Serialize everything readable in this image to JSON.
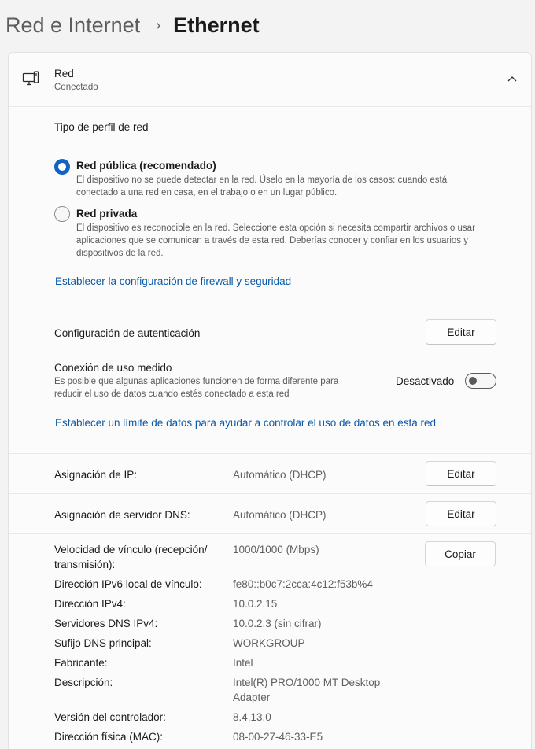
{
  "breadcrumb": {
    "parent": "Red e Internet",
    "separator": "›",
    "current": "Ethernet"
  },
  "network": {
    "name": "Red",
    "status": "Conectado",
    "icon": "computer-network-icon",
    "expand_icon": "chevron-up-icon"
  },
  "profile": {
    "heading": "Tipo de perfil de red",
    "options": [
      {
        "label": "Red pública (recomendado)",
        "selected": true,
        "desc1": "El dispositivo no se puede detectar en la red. Úselo en la mayoría de los casos: cuando está",
        "desc2": "conectado a una red en casa, en el trabajo o en un lugar público."
      },
      {
        "label": "Red privada",
        "selected": false,
        "desc1": "El dispositivo es reconocible en la red. Seleccione esta opción si necesita compartir archivos o usar",
        "desc2": "aplicaciones que se comunican a través de esta red. Deberías conocer y confiar en los usuarios y",
        "desc3": "dispositivos de la red."
      }
    ],
    "firewall_link": "Establecer la configuración de firewall y seguridad"
  },
  "auth": {
    "label": "Configuración de autenticación",
    "button": "Editar"
  },
  "metered": {
    "label": "Conexión de uso medido",
    "desc1": "Es posible que algunas aplicaciones funcionen de forma diferente para",
    "desc2": "reducir el uso de datos cuando estés conectado a esta red",
    "state": "Desactivado",
    "enabled": false,
    "data_limit_link": "Establecer un límite de datos para ayudar a controlar el uso de datos en esta red"
  },
  "ip": {
    "label": "Asignación de IP:",
    "value": "Automático (DHCP)",
    "button": "Editar"
  },
  "dns": {
    "label": "Asignación de servidor DNS:",
    "value": "Automático (DHCP)",
    "button": "Editar"
  },
  "props": {
    "copy_button": "Copiar",
    "link_speed_label_1": "Velocidad de vínculo (recepción/",
    "link_speed_label_2": "transmisión):",
    "link_speed_value": "1000/1000 (Mbps)",
    "ipv6_label": "Dirección IPv6 local de vínculo:",
    "ipv6_value": "fe80::b0c7:2cca:4c12:f53b%4",
    "ipv4_label": "Dirección IPv4:",
    "ipv4_value": "10.0.2.15",
    "dns_label": "Servidores DNS IPv4:",
    "dns_value": "10.0.2.3 (sin cifrar)",
    "suffix_label": "Sufijo DNS principal:",
    "suffix_value": "WORKGROUP",
    "maker_label": "Fabricante:",
    "maker_value": "Intel",
    "desc_label": "Descripción:",
    "desc_value_1": "Intel(R) PRO/1000 MT Desktop",
    "desc_value_2": "Adapter",
    "driver_label": "Versión del controlador:",
    "driver_value": "8.4.13.0",
    "mac_label": "Dirección física (MAC):",
    "mac_value": "08-00-27-46-33-E5"
  },
  "colors": {
    "accent": "#0f63c4",
    "link": "#0a5aa8"
  }
}
